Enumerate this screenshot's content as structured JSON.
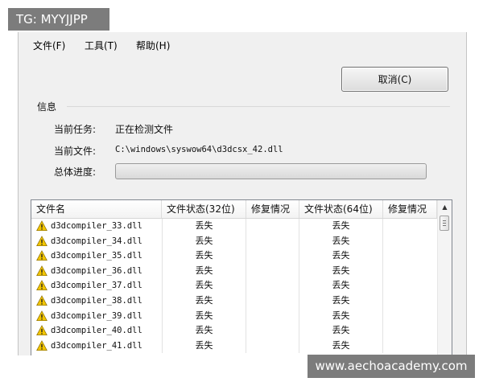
{
  "watermarks": {
    "top_left": "TG: MYYJJPP",
    "bottom_right": "www.aechoacademy.com"
  },
  "menu": {
    "items": [
      {
        "label": "文件(F)"
      },
      {
        "label": "工具(T)"
      },
      {
        "label": "帮助(H)"
      }
    ]
  },
  "cancel_button": {
    "label": "取消(C)"
  },
  "info": {
    "group_title": "信息",
    "current_task_label": "当前任务:",
    "current_task_value": "正在检测文件",
    "current_file_label": "当前文件:",
    "current_file_value": "C:\\windows\\syswow64\\d3dcsx_42.dll",
    "progress_label": "总体进度:",
    "progress_value": 0
  },
  "table": {
    "columns": [
      "文件名",
      "文件状态(32位)",
      "修复情况",
      "文件状态(64位)",
      "修复情况"
    ],
    "rows": [
      {
        "name": "d3dcompiler_33.dll",
        "status32": "丢失",
        "repair32": "",
        "status64": "丢失",
        "repair64": ""
      },
      {
        "name": "d3dcompiler_34.dll",
        "status32": "丢失",
        "repair32": "",
        "status64": "丢失",
        "repair64": ""
      },
      {
        "name": "d3dcompiler_35.dll",
        "status32": "丢失",
        "repair32": "",
        "status64": "丢失",
        "repair64": ""
      },
      {
        "name": "d3dcompiler_36.dll",
        "status32": "丢失",
        "repair32": "",
        "status64": "丢失",
        "repair64": ""
      },
      {
        "name": "d3dcompiler_37.dll",
        "status32": "丢失",
        "repair32": "",
        "status64": "丢失",
        "repair64": ""
      },
      {
        "name": "d3dcompiler_38.dll",
        "status32": "丢失",
        "repair32": "",
        "status64": "丢失",
        "repair64": ""
      },
      {
        "name": "d3dcompiler_39.dll",
        "status32": "丢失",
        "repair32": "",
        "status64": "丢失",
        "repair64": ""
      },
      {
        "name": "d3dcompiler_40.dll",
        "status32": "丢失",
        "repair32": "",
        "status64": "丢失",
        "repair64": ""
      },
      {
        "name": "d3dcompiler_41.dll",
        "status32": "丢失",
        "repair32": "",
        "status64": "丢失",
        "repair64": ""
      }
    ],
    "row_icon": "warning-icon",
    "warning_color": "#f2c500"
  }
}
